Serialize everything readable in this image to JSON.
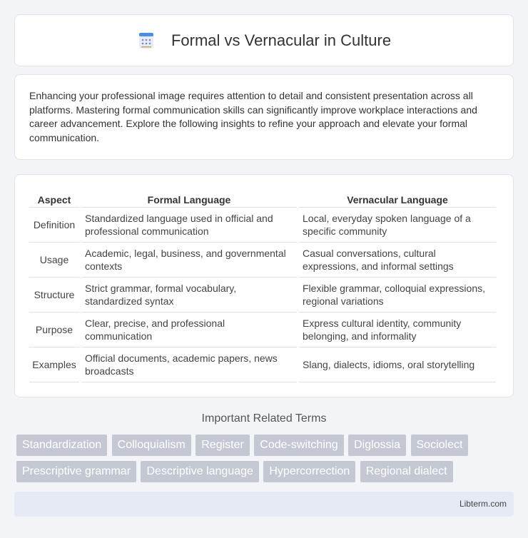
{
  "header": {
    "title": "Formal vs Vernacular in Culture",
    "icon": "document-list-icon"
  },
  "intro": {
    "text": "Enhancing your professional image requires attention to detail and consistent presentation across all platforms. Mastering formal communication skills can significantly improve workplace interactions and career advancement. Explore the following insights to refine your approach and elevate your formal communication."
  },
  "table": {
    "headers": [
      "Aspect",
      "Formal Language",
      "Vernacular Language"
    ],
    "rows": [
      {
        "aspect": "Definition",
        "formal": "Standardized language used in official and professional communication",
        "vernacular": "Local, everyday spoken language of a specific community"
      },
      {
        "aspect": "Usage",
        "formal": "Academic, legal, business, and governmental contexts",
        "vernacular": "Casual conversations, cultural expressions, and informal settings"
      },
      {
        "aspect": "Structure",
        "formal": "Strict grammar, formal vocabulary, standardized syntax",
        "vernacular": "Flexible grammar, colloquial expressions, regional variations"
      },
      {
        "aspect": "Purpose",
        "formal": "Clear, precise, and professional communication",
        "vernacular": "Express cultural identity, community belonging, and informality"
      },
      {
        "aspect": "Examples",
        "formal": "Official documents, academic papers, news broadcasts",
        "vernacular": "Slang, dialects, idioms, oral storytelling"
      }
    ]
  },
  "related": {
    "heading": "Important Related Terms",
    "tags": [
      "Standardization",
      "Colloquialism",
      "Register",
      "Code-switching",
      "Diglossia",
      "Sociolect",
      "Prescriptive grammar",
      "Descriptive language",
      "Hypercorrection",
      "Regional dialect"
    ]
  },
  "footer": {
    "text": "Libterm.com"
  },
  "colors": {
    "background": "#f3f4f8",
    "tag": "#c3c8d3",
    "footer": "#e6eaf5",
    "icon_accent": "#4a90e2"
  }
}
